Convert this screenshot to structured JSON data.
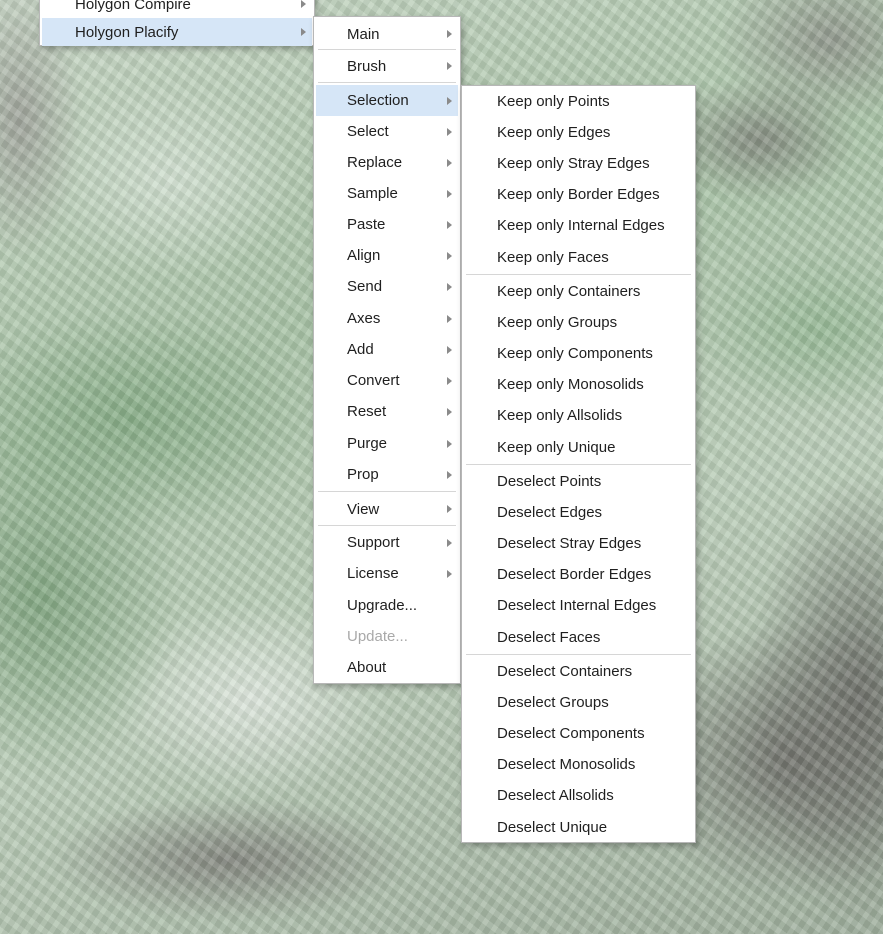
{
  "root_menu": {
    "items": [
      {
        "label": "Holygon Compire",
        "submenu": true,
        "highlighted": false
      },
      {
        "label": "Holygon Placify",
        "submenu": true,
        "highlighted": true
      }
    ]
  },
  "placify_menu": {
    "items": [
      {
        "label": "Main",
        "submenu": true
      },
      {
        "label": "Brush",
        "submenu": true
      },
      {
        "label": "Selection",
        "submenu": true,
        "highlighted": true
      },
      {
        "label": "Select",
        "submenu": true
      },
      {
        "label": "Replace",
        "submenu": true
      },
      {
        "label": "Sample",
        "submenu": true
      },
      {
        "label": "Paste",
        "submenu": true
      },
      {
        "label": "Align",
        "submenu": true
      },
      {
        "label": "Send",
        "submenu": true
      },
      {
        "label": "Axes",
        "submenu": true
      },
      {
        "label": "Add",
        "submenu": true
      },
      {
        "label": "Convert",
        "submenu": true
      },
      {
        "label": "Reset",
        "submenu": true
      },
      {
        "label": "Purge",
        "submenu": true
      },
      {
        "label": "Prop",
        "submenu": true
      },
      {
        "label": "View",
        "submenu": true
      },
      {
        "label": "Support",
        "submenu": true
      },
      {
        "label": "License",
        "submenu": true
      },
      {
        "label": "Upgrade...",
        "submenu": false
      },
      {
        "label": "Update...",
        "submenu": false,
        "disabled": true
      },
      {
        "label": "About",
        "submenu": false
      }
    ]
  },
  "selection_menu": {
    "items": [
      {
        "label": "Keep only Points"
      },
      {
        "label": "Keep only Edges"
      },
      {
        "label": "Keep only Stray Edges"
      },
      {
        "label": "Keep only Border Edges"
      },
      {
        "label": "Keep only Internal Edges"
      },
      {
        "label": "Keep only Faces"
      },
      {
        "label": "Keep only Containers"
      },
      {
        "label": "Keep only Groups"
      },
      {
        "label": "Keep only Components"
      },
      {
        "label": "Keep only Monosolids"
      },
      {
        "label": "Keep only Allsolids"
      },
      {
        "label": "Keep only Unique"
      },
      {
        "label": "Deselect Points"
      },
      {
        "label": "Deselect Edges"
      },
      {
        "label": "Deselect Stray Edges"
      },
      {
        "label": "Deselect Border Edges"
      },
      {
        "label": "Deselect Internal Edges"
      },
      {
        "label": "Deselect Faces"
      },
      {
        "label": "Deselect Containers"
      },
      {
        "label": "Deselect Groups"
      },
      {
        "label": "Deselect Components"
      },
      {
        "label": "Deselect Monosolids"
      },
      {
        "label": "Deselect Allsolids"
      },
      {
        "label": "Deselect Unique"
      }
    ]
  },
  "colors": {
    "highlight": "#d6e6f7",
    "menu_background": "#ffffff",
    "separator": "#d6d6d6",
    "disabled_text": "#a9a9a9"
  }
}
